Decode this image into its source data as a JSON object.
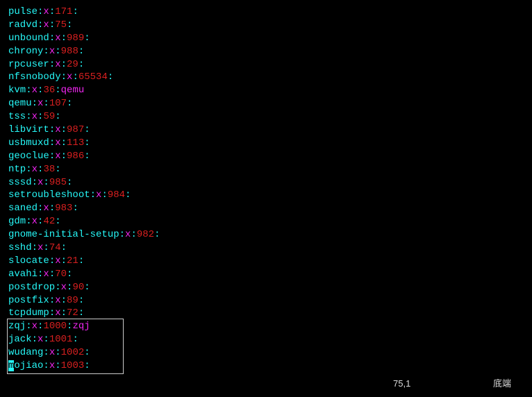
{
  "entries": [
    {
      "user": "pulse",
      "uid": "171",
      "extra": ""
    },
    {
      "user": "radvd",
      "uid": "75",
      "extra": ""
    },
    {
      "user": "unbound",
      "uid": "989",
      "extra": ""
    },
    {
      "user": "chrony",
      "uid": "988",
      "extra": ""
    },
    {
      "user": "rpcuser",
      "uid": "29",
      "extra": ""
    },
    {
      "user": "nfsnobody",
      "uid": "65534",
      "extra": ""
    },
    {
      "user": "kvm",
      "uid": "36",
      "extra": "qemu"
    },
    {
      "user": "qemu",
      "uid": "107",
      "extra": ""
    },
    {
      "user": "tss",
      "uid": "59",
      "extra": ""
    },
    {
      "user": "libvirt",
      "uid": "987",
      "extra": ""
    },
    {
      "user": "usbmuxd",
      "uid": "113",
      "extra": ""
    },
    {
      "user": "geoclue",
      "uid": "986",
      "extra": ""
    },
    {
      "user": "ntp",
      "uid": "38",
      "extra": ""
    },
    {
      "user": "sssd",
      "uid": "985",
      "extra": ""
    },
    {
      "user": "setroubleshoot",
      "uid": "984",
      "extra": ""
    },
    {
      "user": "saned",
      "uid": "983",
      "extra": ""
    },
    {
      "user": "gdm",
      "uid": "42",
      "extra": ""
    },
    {
      "user": "gnome-initial-setup",
      "uid": "982",
      "extra": ""
    },
    {
      "user": "sshd",
      "uid": "74",
      "extra": ""
    },
    {
      "user": "slocate",
      "uid": "21",
      "extra": ""
    },
    {
      "user": "avahi",
      "uid": "70",
      "extra": ""
    },
    {
      "user": "postdrop",
      "uid": "90",
      "extra": ""
    },
    {
      "user": "postfix",
      "uid": "89",
      "extra": ""
    },
    {
      "user": "tcpdump",
      "uid": "72",
      "extra": ""
    },
    {
      "user": "zqj",
      "uid": "1000",
      "extra": "zqj"
    },
    {
      "user": "jack",
      "uid": "1001",
      "extra": ""
    },
    {
      "user": "wudang",
      "uid": "1002",
      "extra": ""
    },
    {
      "user": "mojiao",
      "uid": "1003",
      "extra": "",
      "cursor_first_char": true
    }
  ],
  "highlight_box_start_index": 24,
  "highlight_box_end_index": 27,
  "status": {
    "position": "75,1",
    "label": "底端"
  }
}
